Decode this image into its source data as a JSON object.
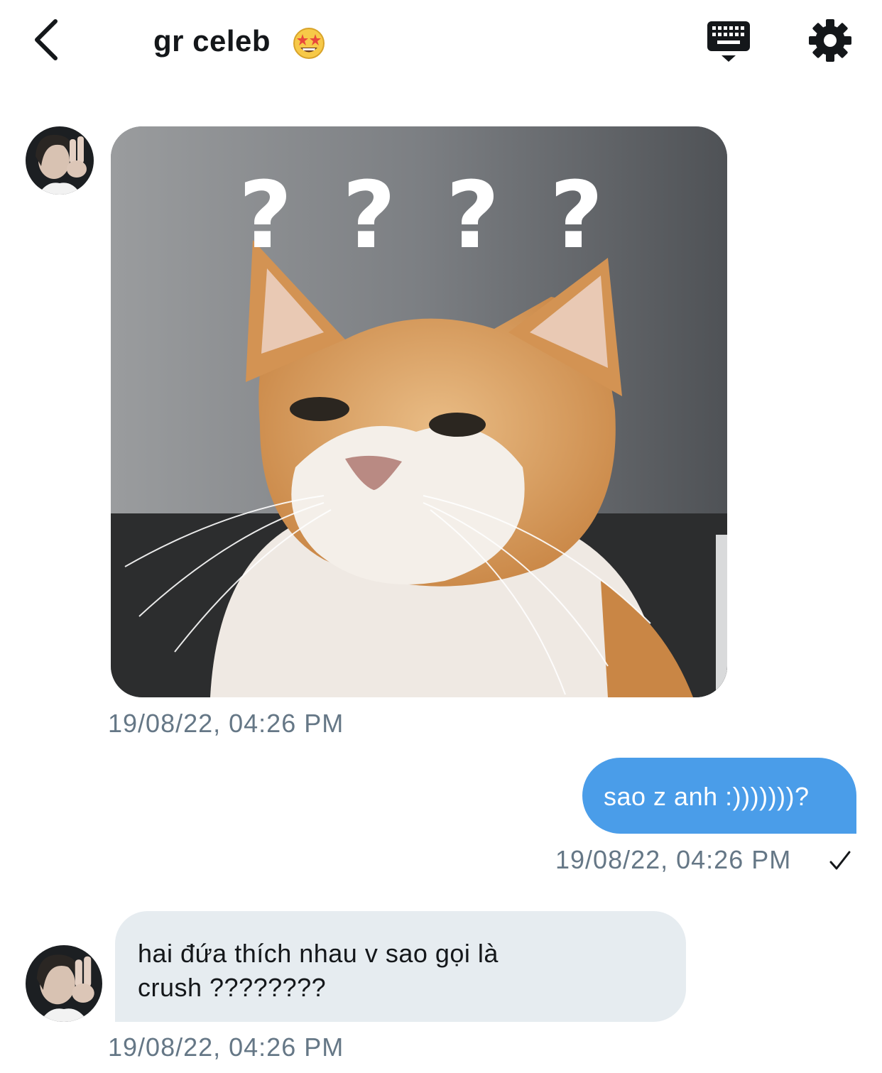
{
  "header": {
    "title": "gr celeb",
    "title_emoji": "star-struck-emoji",
    "icons": [
      "back-chevron-icon",
      "keyboard-icon",
      "gear-icon"
    ]
  },
  "messages": [
    {
      "direction": "incoming",
      "type": "image",
      "image_desc": "cat-meme",
      "timestamp": "19/08/22, 04:26 PM"
    },
    {
      "direction": "outgoing",
      "type": "text",
      "text": "sao z anh :)))))))?",
      "timestamp": "19/08/22, 04:26 PM",
      "status_icon": "check-icon"
    },
    {
      "direction": "incoming",
      "type": "text",
      "text_line1": "hai đứa thích nhau v sao gọi là",
      "text_line2": "crush ????????",
      "timestamp": "19/08/22, 04:26 PM"
    }
  ],
  "colors": {
    "outgoing_bubble": "#4a9de9",
    "incoming_bubble": "#e6ecf0",
    "timestamp": "#657786",
    "text": "#14171a"
  }
}
